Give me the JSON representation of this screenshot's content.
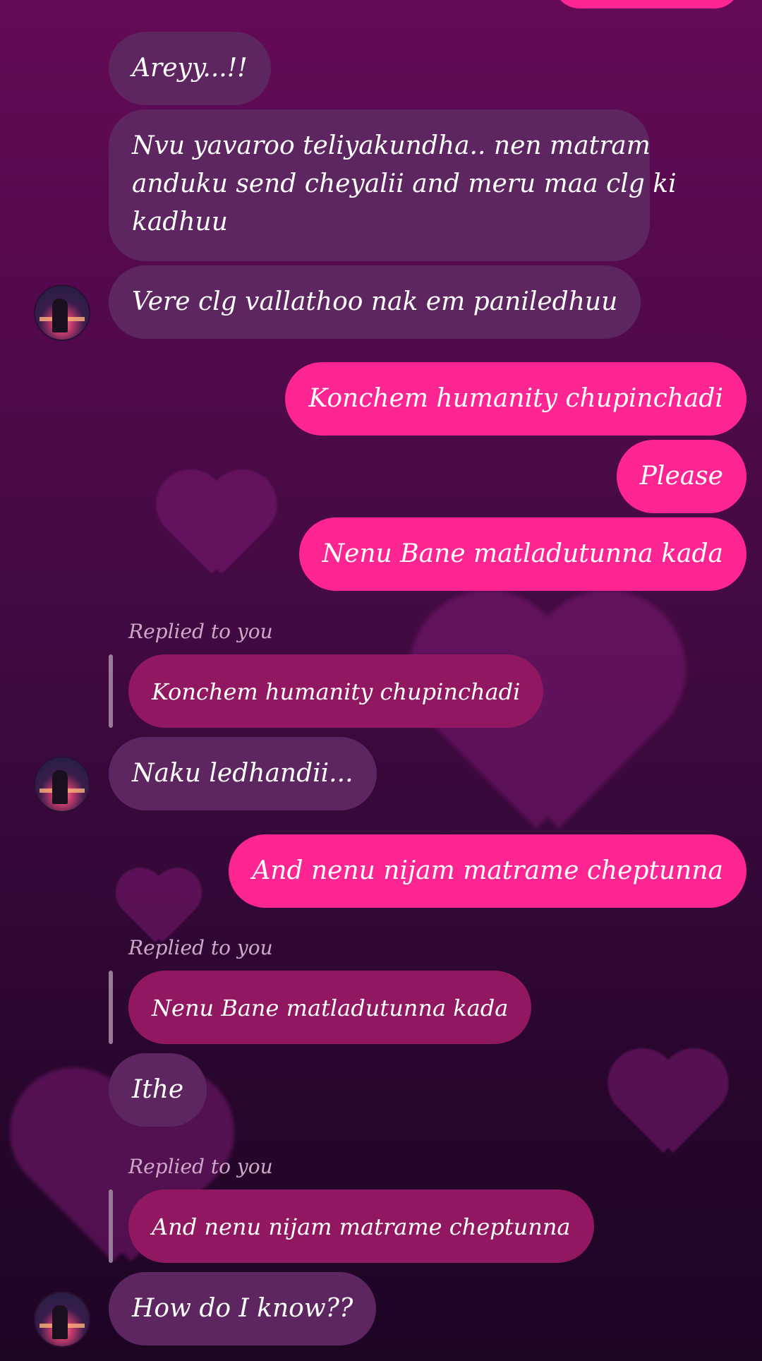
{
  "messages": {
    "m1": "Areyy...!!",
    "m2_line1": "Nvu yavaroo teliyakundha.. nen matram",
    "m2_line2": "anduku send cheyalii and meru maa clg ki",
    "m2_line3": "kadhuu",
    "m3": "Vere clg vallathoo nak em paniledhuu",
    "m4": "Konchem humanity chupinchadi",
    "m5": "Please",
    "m6": "Nenu Bane matladutunna kada",
    "r1_label": "Replied to you",
    "r1_quote": "Konchem humanity chupinchadi",
    "m7": "Naku ledhandii...",
    "m8": "And nenu nijam matrame cheptunna",
    "r2_label": "Replied to you",
    "r2_quote": "Nenu Bane matladutunna kada",
    "m9": "Ithe",
    "r3_label": "Replied to you",
    "r3_quote": "And nenu nijam matrame cheptunna",
    "m10": "How do I know??"
  },
  "colors": {
    "incoming_bubble": "#5e2660",
    "outgoing_bubble": "#fc2592",
    "quote_bubble": "#911860",
    "reply_label": "#cfa8c8"
  }
}
